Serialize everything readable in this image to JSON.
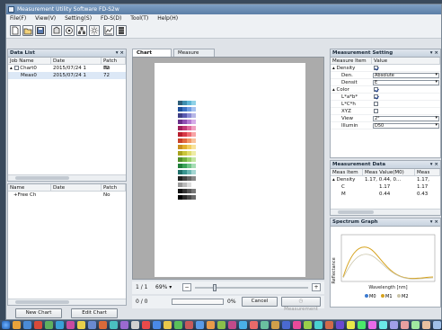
{
  "window": {
    "title": "Measurement Utility Software FD-S2w"
  },
  "menu": [
    "File(F)",
    "View(V)",
    "Setting(S)",
    "FD-S(D)",
    "Tool(T)",
    "Help(H)"
  ],
  "toolbar_icons": [
    "new-file-icon",
    "open-folder-icon",
    "save-icon",
    "measure-icon",
    "target-icon",
    "network-icon",
    "light-icon",
    "graph-icon",
    "chart-grid-icon"
  ],
  "data_list": {
    "title": "Data List",
    "columns": [
      "Job Name",
      "Date",
      "Patch No"
    ],
    "rows": [
      {
        "name": "Chart0",
        "date": "2015/07/24 1",
        "patch": "72"
      },
      {
        "name": "Meas0",
        "date": "2015/07/24 1",
        "patch": "72"
      }
    ]
  },
  "lower_list": {
    "columns": [
      "Name",
      "Date",
      "Patch No"
    ],
    "rows": [
      {
        "name": "Free Ch",
        "date": "",
        "patch": ""
      }
    ]
  },
  "buttons": {
    "new_chart": "New Chart",
    "edit_chart": "Edit Chart"
  },
  "tabs": [
    {
      "label": "Chart Layout",
      "active": true
    },
    {
      "label": "Measure Point",
      "active": false
    }
  ],
  "bottom_bar": {
    "page": "1 / 1",
    "zoom": "69%",
    "progress_text": "0 / 0",
    "progress_pct": "0%",
    "cancel": "Cancel",
    "measurement": "Measurement"
  },
  "measurement_setting": {
    "title": "Measurement Setting",
    "columns": [
      "Measure Item",
      "Value"
    ],
    "rows": [
      {
        "key": "Density",
        "value": "",
        "check": true,
        "indent": 0
      },
      {
        "key": "Den.",
        "value": "Absolute",
        "combo": true,
        "indent": 1
      },
      {
        "key": "Densit",
        "value": "E",
        "combo": true,
        "indent": 1
      },
      {
        "key": "Color",
        "value": "",
        "check": true,
        "indent": 0
      },
      {
        "key": "L*a*b*",
        "value": "",
        "check": true,
        "indent": 1
      },
      {
        "key": "L*C*h",
        "value": "",
        "check": false,
        "indent": 1
      },
      {
        "key": "XYZ",
        "value": "",
        "check": false,
        "indent": 1
      },
      {
        "key": "View",
        "value": "2°",
        "combo": true,
        "indent": 1
      },
      {
        "key": "Illumin",
        "value": "D50",
        "combo": true,
        "indent": 1
      }
    ]
  },
  "measurement_data": {
    "title": "Measurement Data",
    "columns": [
      "Meas Item",
      "Meas Value(M0)",
      "Meas"
    ],
    "rows": [
      {
        "key": "Density",
        "v1": "1.17, 0.44, 0...",
        "v2": "1.17,"
      },
      {
        "key": "C",
        "v1": "1.17",
        "v2": "1.17"
      },
      {
        "key": "M",
        "v1": "0.44",
        "v2": "0.43"
      }
    ]
  },
  "spectrum_graph": {
    "title": "Spectrum Graph",
    "ylabel": "Reflectance",
    "xlabel": "Wavelength [nm]",
    "legend": [
      "M0",
      "M1",
      "M2"
    ],
    "colors": [
      "#3a7ad1",
      "#d6a21c",
      "#c9c4a8"
    ]
  },
  "color_chart": {
    "columns": 4,
    "patches": [
      "#2f5f7a",
      "#3f8fb0",
      "#5fb6d6",
      "#8fd1e6",
      "#1d4f9c",
      "#3e72c4",
      "#6d9ae0",
      "#a6c2f0",
      "#3d3d86",
      "#5a5ab0",
      "#8a8ad4",
      "#b7b7e6",
      "#6a2f8a",
      "#8f4fb2",
      "#b47bd2",
      "#d6abe8",
      "#9e1f5a",
      "#c23a78",
      "#de6a9c",
      "#f0a0c2",
      "#b81d2d",
      "#d83a46",
      "#ee6b72",
      "#f7a4a6",
      "#c8422a",
      "#e26a40",
      "#f29766",
      "#f8c29c",
      "#c98f1d",
      "#e2b02f",
      "#f1cd5e",
      "#f8e29a",
      "#a8a21e",
      "#c9c53a",
      "#e0dc6b",
      "#eeeca6",
      "#4f8f2a",
      "#6fb140",
      "#98cf6a",
      "#c3e5a2",
      "#1f7f3a",
      "#3ba35a",
      "#6ec486",
      "#a6dcb4",
      "#1f6f6a",
      "#3a9590",
      "#6cb8b4",
      "#a4d6d2",
      "#222222",
      "#444444",
      "#666666",
      "#888888",
      "#999999",
      "#bbbbbb",
      "#dddddd",
      "#ffffff",
      "#111111",
      "#333333",
      "#555555",
      "#777777",
      "#000000",
      "#2a2a2a",
      "#4a4a4a",
      "#6a6a6a"
    ]
  }
}
